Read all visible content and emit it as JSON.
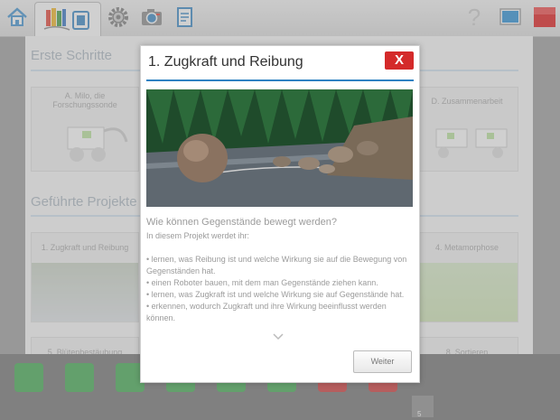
{
  "toolbar": {
    "icons": [
      "home-icon",
      "projects-icon",
      "gear-icon",
      "camera-icon",
      "document-icon",
      "help-icon",
      "display-icon",
      "stop-icon"
    ],
    "help_label": "?"
  },
  "background": {
    "section1_title": "Erste Schritte",
    "section2_title": "Geführte Projekte",
    "cards": {
      "milo": "A. Milo, die Forschungssonde",
      "zusammenarbeit": "D. Zusammenarbeit",
      "zugkraft": "1. Zugkraft und Reibung",
      "metamorphose": "4. Metamorphose",
      "bluete": "5. Blütenbestäubung",
      "sortieren": "8. Sortieren"
    }
  },
  "bottom": {
    "counter": "5"
  },
  "modal": {
    "title": "1. Zugkraft und Reibung",
    "close_label": "X",
    "question": "Wie können Gegenstände bewegt werden?",
    "intro": "In diesem Projekt werdet ihr:",
    "bullets": [
      "• lernen, was Reibung ist und welche Wirkung sie auf die Bewegung von Gegenständen hat.",
      "• einen Roboter bauen, mit dem man Gegenstände ziehen kann.",
      "• lernen, was Zugkraft ist und welche Wirkung sie auf Gegenstände hat.",
      "• erkennen, wodurch Zugkraft und ihre Wirkung beeinflusst werden können."
    ],
    "next_label": "Weiter"
  },
  "colors": {
    "accent_blue": "#2e82c3",
    "close_red": "#d42a2a",
    "stop_red": "#e01010"
  }
}
